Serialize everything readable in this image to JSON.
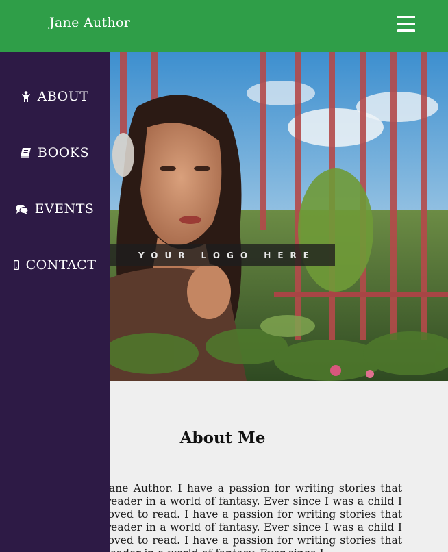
{
  "header": {
    "brand": "Jane Author",
    "menu_icon": "hamburger-menu-icon"
  },
  "sidebar": {
    "items": [
      {
        "label": "ABOUT",
        "icon": "person-icon"
      },
      {
        "label": "BOOKS",
        "icon": "book-icon"
      },
      {
        "label": "EVENTS",
        "icon": "comments-icon"
      },
      {
        "label": "CONTACT",
        "icon": "mobile-phone-icon"
      }
    ]
  },
  "hero": {
    "logo_text": "YOUR LOGO HERE"
  },
  "about": {
    "title": "About Me",
    "body": "My name is Jane Author. I have a passion for writing stories that immerse the reader in a world of fantasy. Ever since I was a child I have always loved to read. I have a passion for writing stories that immerse the reader in a world of fantasy. Ever since I was a child I have always loved to read. I have a passion for writing stories that immerse the reader in a world of fantasy. Ever since I"
  },
  "colors": {
    "header_bg": "#2f9e48",
    "sidebar_bg": "#2d1a45",
    "content_bg": "#efefef"
  }
}
